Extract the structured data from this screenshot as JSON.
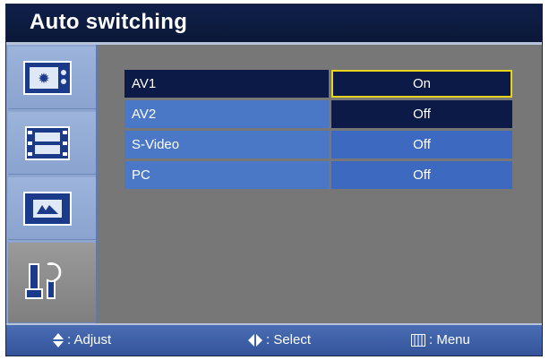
{
  "title": "Auto switching",
  "sidebar": {
    "items": [
      {
        "icon": "picture-icon"
      },
      {
        "icon": "film-icon"
      },
      {
        "icon": "screen-icon"
      },
      {
        "icon": "tools-icon"
      }
    ]
  },
  "options": [
    {
      "label": "AV1",
      "value": "On"
    },
    {
      "label": "AV2",
      "value": "Off"
    },
    {
      "label": "S-Video",
      "value": "Off"
    },
    {
      "label": "PC",
      "value": "Off"
    }
  ],
  "footer": {
    "adjust": ": Adjust",
    "select": ": Select",
    "menu": ": Menu"
  },
  "colors": {
    "accent_focus": "#e9d21a",
    "selected_bg": "#0c1a48",
    "row_bg": "#4a78c6"
  }
}
